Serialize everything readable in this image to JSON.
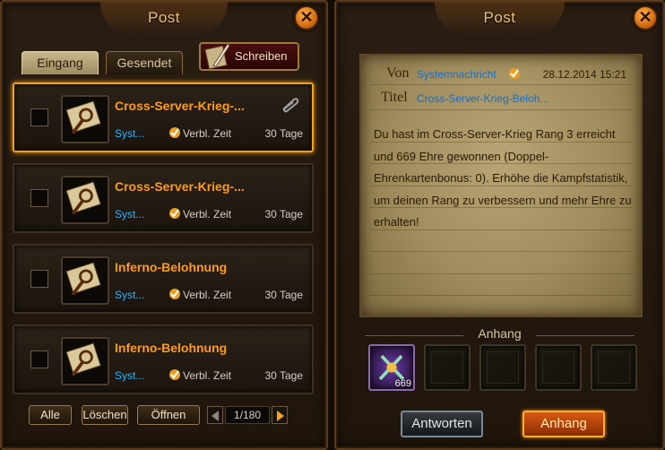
{
  "left_panel": {
    "title": "Post",
    "tabs": [
      {
        "label": "Eingang",
        "active": true
      },
      {
        "label": "Gesendet",
        "active": false
      }
    ],
    "write_label": "Schreiben",
    "mails": [
      {
        "subject": "Cross-Server-Krieg-...",
        "sender": "Syst...",
        "remaining_label": "Verbl. Zeit",
        "days": "30 Tage",
        "has_attachment": true,
        "selected": true
      },
      {
        "subject": "Cross-Server-Krieg-...",
        "sender": "Syst...",
        "remaining_label": "Verbl. Zeit",
        "days": "30 Tage",
        "has_attachment": false,
        "selected": false
      },
      {
        "subject": "Inferno-Belohnung",
        "sender": "Syst...",
        "remaining_label": "Verbl. Zeit",
        "days": "30 Tage",
        "has_attachment": false,
        "selected": false
      },
      {
        "subject": "Inferno-Belohnung",
        "sender": "Syst...",
        "remaining_label": "Verbl. Zeit",
        "days": "30 Tage",
        "has_attachment": false,
        "selected": false
      }
    ],
    "buttons": {
      "all": "Alle",
      "delete": "Löschen",
      "open": "Öffnen"
    },
    "pagination": "1/180"
  },
  "right_panel": {
    "title": "Post",
    "from_label": "Von",
    "from_value": "Systemnachricht",
    "date": "28.12.2014 15:21",
    "title_label": "Titel",
    "title_value": "Cross-Server-Krieg-Beloh...",
    "body": "Du hast im Cross-Server-Krieg Rang 3 erreicht und 669 Ehre gewonnen (Doppel-Ehrenkartenbonus: 0). Erhöhe die Kampfstatistik, um deinen Rang zu verbessern und mehr Ehre zu erhalten!",
    "attachments_label": "Anhang",
    "attachments": [
      {
        "filled": true,
        "count": "669"
      },
      {
        "filled": false,
        "count": ""
      },
      {
        "filled": false,
        "count": ""
      },
      {
        "filled": false,
        "count": ""
      },
      {
        "filled": false,
        "count": ""
      }
    ],
    "reply_label": "Antworten",
    "attach_button_label": "Anhang"
  },
  "colors": {
    "accent_orange": "#ff9c1a",
    "link_blue": "#2ab6ff",
    "gold_title": "#e8c27a"
  }
}
